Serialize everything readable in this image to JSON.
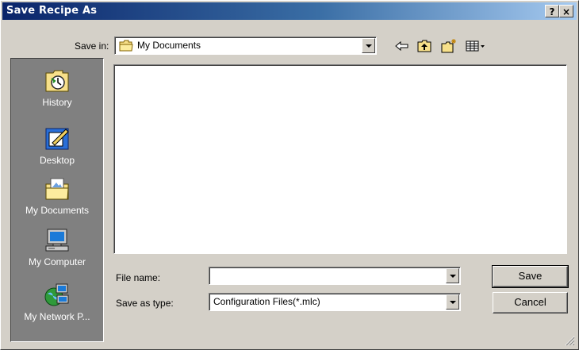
{
  "window": {
    "title": "Save Recipe As",
    "help_label": "?",
    "close_label": "×"
  },
  "toolbar": {
    "save_in_label": "Save in:",
    "save_in_value": "My Documents",
    "icons": [
      "back-arrow-icon",
      "up-one-level-icon",
      "new-folder-icon",
      "view-menu-icon"
    ]
  },
  "places": [
    {
      "label": "History",
      "icon": "history-icon"
    },
    {
      "label": "Desktop",
      "icon": "desktop-icon"
    },
    {
      "label": "My Documents",
      "icon": "my-documents-icon"
    },
    {
      "label": "My Computer",
      "icon": "my-computer-icon"
    },
    {
      "label": "My Network P...",
      "icon": "my-network-places-icon"
    }
  ],
  "form": {
    "file_name_label": "File name:",
    "file_name_value": "",
    "save_as_type_label": "Save as type:",
    "save_as_type_value": "Configuration Files(*.mlc)"
  },
  "buttons": {
    "save": "Save",
    "cancel": "Cancel"
  },
  "colors": {
    "titlebar_start": "#0a246a",
    "titlebar_end": "#a6caf0",
    "face": "#d4d0c8",
    "places_bg": "#808080"
  }
}
